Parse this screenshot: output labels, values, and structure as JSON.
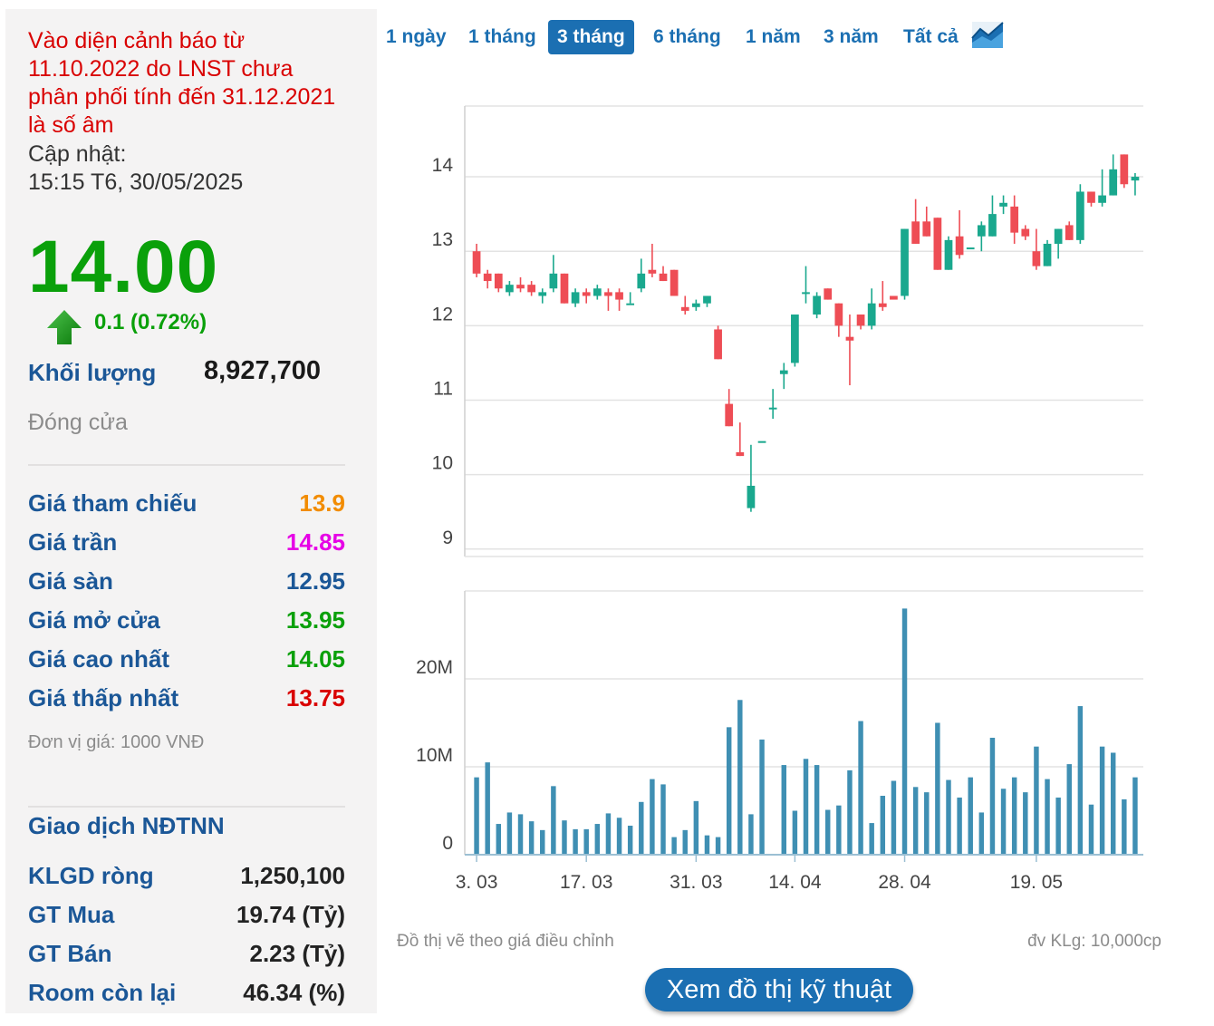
{
  "warning": "Vào diện cảnh báo từ 11.10.2022 do LNST chưa phân phối tính đến 31.12.2021 là số âm",
  "update_label": "Cập nhật:",
  "update_time": "15:15 T6, 30/05/2025",
  "price": "14.00",
  "change": "0.1 (0.72%)",
  "volume_label": "Khối lượng",
  "volume": "8,927,700",
  "status": "Đóng cửa",
  "price_rows": [
    {
      "label": "Giá tham chiếu",
      "value": "13.9",
      "color": "#f28c00"
    },
    {
      "label": "Giá trần",
      "value": "14.85",
      "color": "#e600e6"
    },
    {
      "label": "Giá sàn",
      "value": "12.95",
      "color": "#1b5797"
    },
    {
      "label": "Giá mở cửa",
      "value": "13.95",
      "color": "#0aa00a"
    },
    {
      "label": "Giá cao nhất",
      "value": "14.05",
      "color": "#0aa00a"
    },
    {
      "label": "Giá thấp nhất",
      "value": "13.75",
      "color": "#d90000"
    }
  ],
  "unit_note": "Đơn vị giá: 1000 VNĐ",
  "foreign_title": "Giao dịch NĐTNN",
  "foreign_rows": [
    {
      "label": "KLGD ròng",
      "value": "1,250,100"
    },
    {
      "label": "GT Mua",
      "value": "19.74 (Tỷ)"
    },
    {
      "label": "GT Bán",
      "value": "2.23 (Tỷ)"
    },
    {
      "label": "Room còn lại",
      "value": "46.34 (%)"
    }
  ],
  "tabs": [
    {
      "label": "1 ngày",
      "active": false
    },
    {
      "label": "1 tháng",
      "active": false
    },
    {
      "label": "3 tháng",
      "active": true
    },
    {
      "label": "6 tháng",
      "active": false
    },
    {
      "label": "1 năm",
      "active": false
    },
    {
      "label": "3 năm",
      "active": false
    },
    {
      "label": "Tất cả",
      "active": false
    }
  ],
  "chart_icon": "area-chart-icon",
  "note_left": "Đồ thị vẽ theo giá điều chỉnh",
  "note_right": "đv KLg: 10,000cp",
  "tech_button": "Xem đồ thị kỹ thuật",
  "colors": {
    "up": "#1aa88e",
    "down": "#ee4d55",
    "volume": "#3f8fb3",
    "accent": "#1b6fb2"
  },
  "chart_data": [
    {
      "type": "candlestick",
      "y_ticks": [
        9,
        10,
        11,
        12,
        13,
        14
      ],
      "ylim": [
        8.9,
        14.95
      ],
      "x_tick_labels": [
        {
          "label": "3. 03",
          "index": 0
        },
        {
          "label": "17. 03",
          "index": 10
        },
        {
          "label": "31. 03",
          "index": 20
        },
        {
          "label": "14. 04",
          "index": 29
        },
        {
          "label": "28. 04",
          "index": 39
        },
        {
          "label": "19. 05",
          "index": 51
        }
      ],
      "candles": [
        [
          13.0,
          12.7,
          13.1,
          12.65
        ],
        [
          12.7,
          12.6,
          12.75,
          12.5
        ],
        [
          12.7,
          12.5,
          12.7,
          12.45
        ],
        [
          12.45,
          12.55,
          12.6,
          12.4
        ],
        [
          12.55,
          12.5,
          12.65,
          12.45
        ],
        [
          12.55,
          12.45,
          12.6,
          12.4
        ],
        [
          12.4,
          12.45,
          12.5,
          12.3
        ],
        [
          12.5,
          12.7,
          12.95,
          12.45
        ],
        [
          12.7,
          12.3,
          12.7,
          12.3
        ],
        [
          12.3,
          12.45,
          12.5,
          12.25
        ],
        [
          12.45,
          12.4,
          12.5,
          12.3
        ],
        [
          12.4,
          12.5,
          12.55,
          12.35
        ],
        [
          12.45,
          12.4,
          12.5,
          12.2
        ],
        [
          12.45,
          12.35,
          12.5,
          12.2
        ],
        [
          12.3,
          12.3,
          12.45,
          12.3
        ],
        [
          12.5,
          12.7,
          12.9,
          12.45
        ],
        [
          12.75,
          12.7,
          13.1,
          12.65
        ],
        [
          12.7,
          12.6,
          12.8,
          12.6
        ],
        [
          12.75,
          12.4,
          12.75,
          12.4
        ],
        [
          12.25,
          12.2,
          12.4,
          12.15
        ],
        [
          12.25,
          12.3,
          12.35,
          12.2
        ],
        [
          12.3,
          12.4,
          12.4,
          12.25
        ],
        [
          11.95,
          11.55,
          12.0,
          11.55
        ],
        [
          10.95,
          10.65,
          11.15,
          10.65
        ],
        [
          10.3,
          10.25,
          10.7,
          10.25
        ],
        [
          9.55,
          9.85,
          10.4,
          9.5
        ],
        [
          10.45,
          10.45,
          10.45,
          10.45
        ],
        [
          10.9,
          10.9,
          11.15,
          10.75
        ],
        [
          11.35,
          11.4,
          11.5,
          11.15
        ],
        [
          11.5,
          12.15,
          12.15,
          11.45
        ],
        [
          12.45,
          12.45,
          12.8,
          12.3
        ],
        [
          12.15,
          12.4,
          12.45,
          12.1
        ],
        [
          12.5,
          12.35,
          12.5,
          12.35
        ],
        [
          12.3,
          12.0,
          12.3,
          11.85
        ],
        [
          11.85,
          11.8,
          12.15,
          11.2
        ],
        [
          12.15,
          12.0,
          12.15,
          11.95
        ],
        [
          12.0,
          12.3,
          12.5,
          11.95
        ],
        [
          12.3,
          12.25,
          12.6,
          12.2
        ],
        [
          12.4,
          12.35,
          12.35,
          12.35
        ],
        [
          12.4,
          13.3,
          13.3,
          12.35
        ],
        [
          13.4,
          13.1,
          13.7,
          13.1
        ],
        [
          13.4,
          13.2,
          13.6,
          13.2
        ],
        [
          13.45,
          12.75,
          13.45,
          12.75
        ],
        [
          12.75,
          13.15,
          13.2,
          12.75
        ],
        [
          13.2,
          12.95,
          13.55,
          12.9
        ],
        [
          13.05,
          13.05,
          13.05,
          13.05
        ],
        [
          13.2,
          13.35,
          13.4,
          13.0
        ],
        [
          13.2,
          13.5,
          13.75,
          13.2
        ],
        [
          13.6,
          13.65,
          13.75,
          13.5
        ],
        [
          13.6,
          13.25,
          13.75,
          13.1
        ],
        [
          13.3,
          13.2,
          13.35,
          13.15
        ],
        [
          13.0,
          12.8,
          13.3,
          12.75
        ],
        [
          12.8,
          13.1,
          13.15,
          12.8
        ],
        [
          13.1,
          13.3,
          13.3,
          12.9
        ],
        [
          13.35,
          13.15,
          13.4,
          13.15
        ],
        [
          13.15,
          13.8,
          13.9,
          13.1
        ],
        [
          13.8,
          13.65,
          13.8,
          13.6
        ],
        [
          13.65,
          13.75,
          14.1,
          13.6
        ],
        [
          13.75,
          14.1,
          14.3,
          13.75
        ],
        [
          14.3,
          13.9,
          14.3,
          13.85
        ],
        [
          13.95,
          14.0,
          14.05,
          13.75
        ]
      ]
    },
    {
      "type": "bar",
      "y_ticks": [
        {
          "value": 0,
          "label": "0"
        },
        {
          "value": 10000000,
          "label": "10M"
        },
        {
          "value": 20000000,
          "label": "20M"
        }
      ],
      "ylim": [
        0,
        30000000
      ],
      "volumes": [
        8.8,
        10.5,
        3.5,
        4.8,
        4.6,
        3.8,
        2.8,
        7.8,
        3.9,
        2.9,
        2.9,
        3.5,
        4.7,
        4.2,
        3.3,
        6.0,
        8.6,
        8.0,
        2.0,
        2.8,
        6.1,
        2.2,
        2.0,
        14.5,
        17.6,
        4.6,
        13.1,
        0,
        10.2,
        5.0,
        10.9,
        10.2,
        5.1,
        5.6,
        9.6,
        15.2,
        3.6,
        6.7,
        8.4,
        28.0,
        7.7,
        7.1,
        15.0,
        8.5,
        6.5,
        8.8,
        4.8,
        13.3,
        7.5,
        8.8,
        7.1,
        12.3,
        8.6,
        6.5,
        10.3,
        16.9,
        5.7,
        12.3,
        11.6,
        6.3,
        8.8
      ]
    }
  ]
}
